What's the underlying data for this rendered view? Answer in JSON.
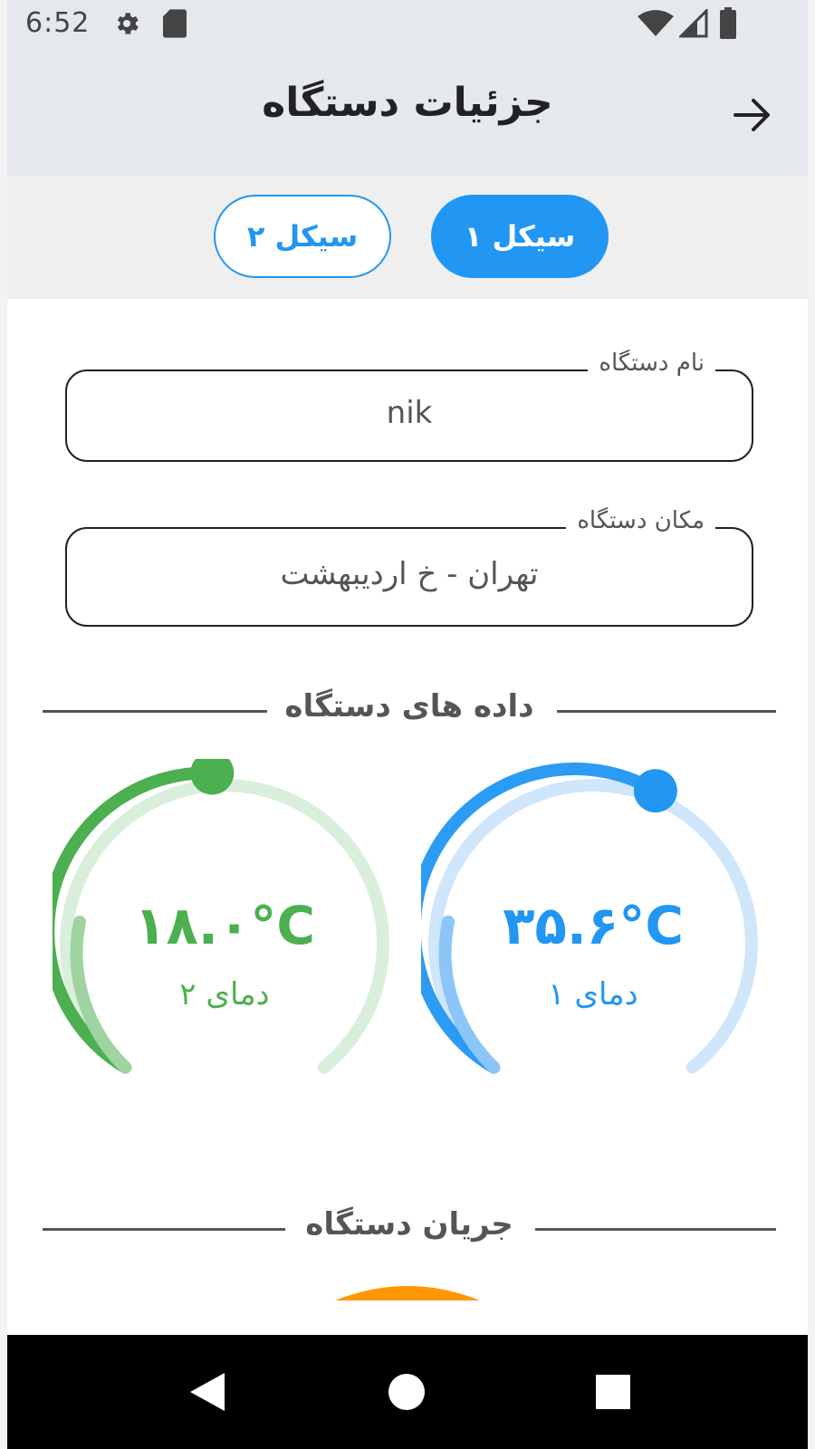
{
  "status_bar": {
    "time": "6:52",
    "icons": [
      "settings-icon",
      "sd-card-icon",
      "wifi-icon",
      "signal-icon",
      "battery-icon"
    ]
  },
  "app_bar": {
    "title": "جزئیات دستگاه",
    "back_icon": "arrow-right-icon"
  },
  "tabs": [
    {
      "label": "سیکل ۱",
      "active": true
    },
    {
      "label": "سیکل ۲",
      "active": false
    }
  ],
  "fields": {
    "device_name": {
      "label": "نام دستگاه",
      "value": "nik"
    },
    "device_location": {
      "label": "مکان دستگاه",
      "value": "تهران - خ اردیبهشت"
    }
  },
  "sections": {
    "device_data": "داده های دستگاه",
    "device_current": "جریان دستگاه"
  },
  "gauges": [
    {
      "key": "temp1",
      "value_text": "۳۵.۶°C",
      "label": "دمای ۱",
      "value": 35.6,
      "color": "#2196f3",
      "track_color": "#cfe6fb"
    },
    {
      "key": "temp2",
      "value_text": "۱۸.۰°C",
      "label": "دمای ۲",
      "value": 18.0,
      "color": "#4caf50",
      "track_color": "#d9efdb"
    }
  ],
  "colors": {
    "primary": "#2196f3",
    "green": "#4caf50",
    "orange": "#ff9800",
    "app_bar_bg": "#e5e9ee"
  },
  "nav": [
    "back-triangle-icon",
    "home-circle-icon",
    "recents-square-icon"
  ]
}
